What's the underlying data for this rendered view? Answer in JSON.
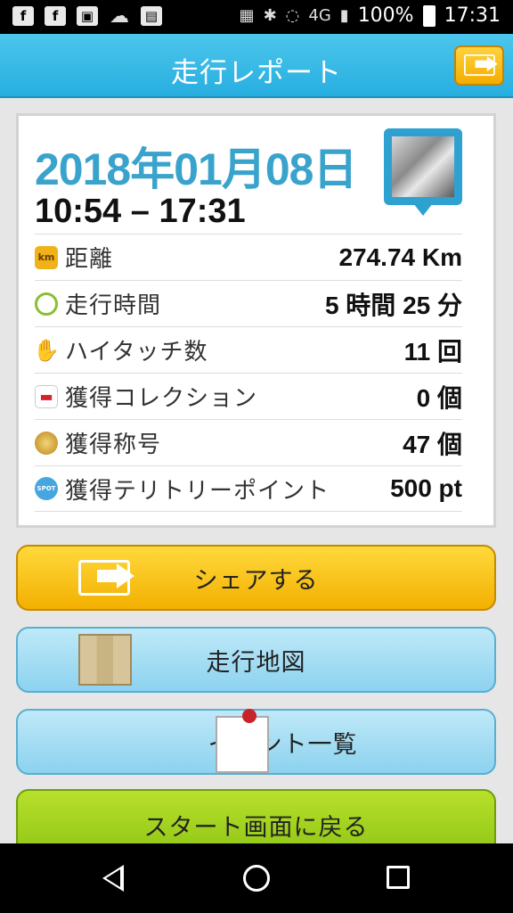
{
  "status_bar": {
    "left_icons": [
      "facebook-icon",
      "facebook-icon",
      "app-icon",
      "cloud-icon",
      "pos-icon"
    ],
    "network": "4G",
    "battery": "100%",
    "time": "17:31"
  },
  "header": {
    "title": "走行レポート"
  },
  "report": {
    "date": "2018年01月08日",
    "time_range": "10:54 – 17:31",
    "stats": [
      {
        "icon": "km-icon",
        "label": "距離",
        "value": "274.74 Km"
      },
      {
        "icon": "clock-icon",
        "label": "走行時間",
        "value": "5 時間 25 分"
      },
      {
        "icon": "hi-touch-hand-icon",
        "label": "ハイタッチ数",
        "value": "11 回"
      },
      {
        "icon": "car-icon",
        "label": "獲得コレクション",
        "value": "0 個"
      },
      {
        "icon": "medal-icon",
        "label": "獲得称号",
        "value": "47 個"
      },
      {
        "icon": "spot-icon",
        "label": "獲得テリトリーポイント",
        "value": "500 pt"
      }
    ]
  },
  "buttons": {
    "share": "シェアする",
    "map": "走行地図",
    "events": "イベント一覧",
    "back_to_start": "スタート画面に戻る"
  },
  "colors": {
    "header": "#33b5e5",
    "date": "#3aa3cc",
    "share_button": "#f6b900",
    "map_button": "#9fd9f2",
    "start_button": "#a2d21c"
  }
}
